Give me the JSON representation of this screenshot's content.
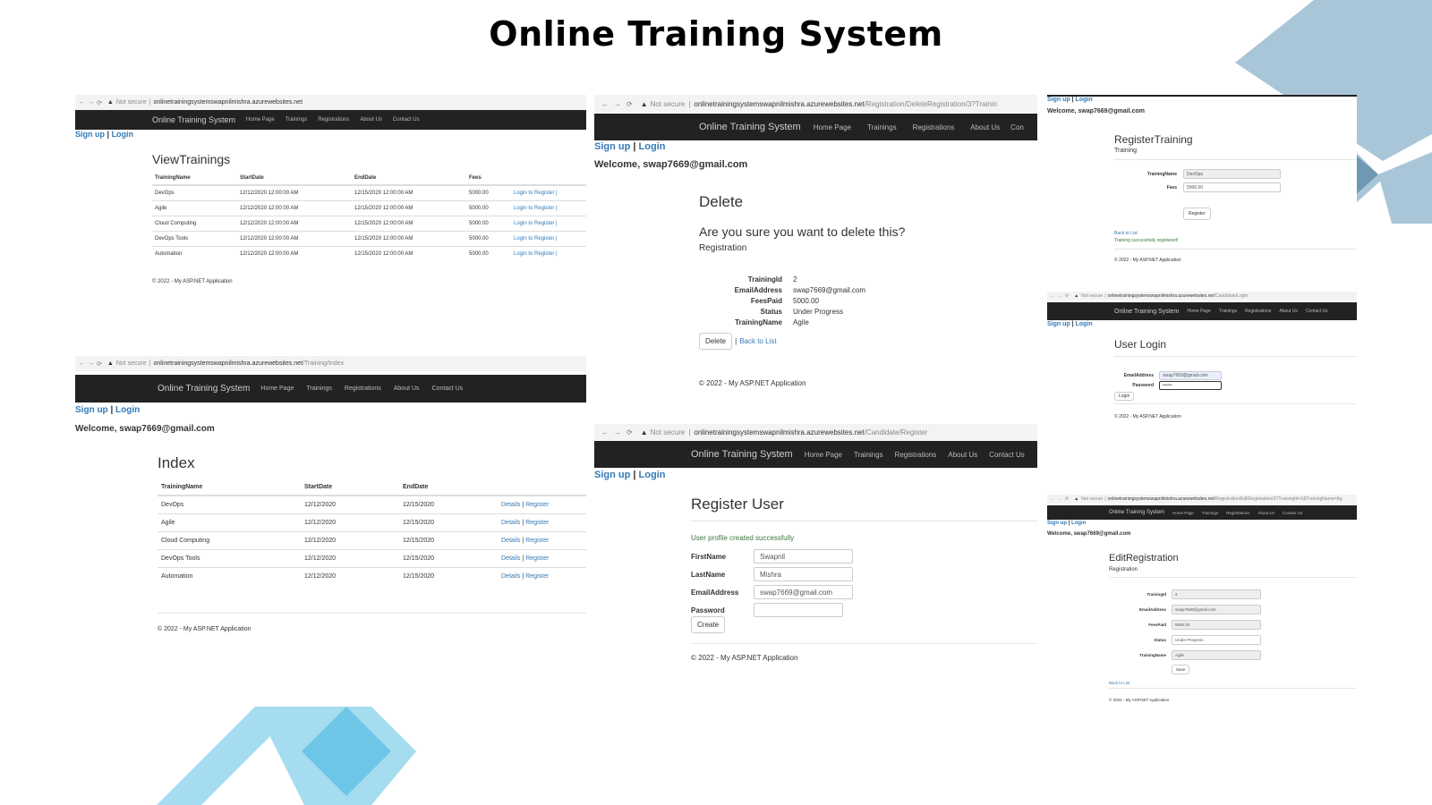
{
  "slide_title": "Online Training System",
  "colors": {
    "deco_dark": "#6f99b3",
    "deco_mid": "#a9c6d8",
    "deco_light": "#a5dcf0",
    "deco_cyan": "#6ec6e7",
    "navbar": "#222222",
    "link": "#337ab7",
    "success": "#3c763d"
  },
  "common": {
    "brand": "Online Training System",
    "nav": [
      "Home Page",
      "Trainings",
      "Registrations",
      "About Us",
      "Contact Us"
    ],
    "signup": "Sign up",
    "login": "Login",
    "sep": "|",
    "not_secure": "Not secure",
    "welcome": "Welcome, swap7669@gmail.com",
    "footer": "© 2022 - My ASP.NET Application",
    "host": "onlinetrainingsystemswapnilmishra.azurewebsites.net"
  },
  "view_trainings": {
    "url_path": "",
    "signup": "Sign up",
    "title": "ViewTrainings",
    "headers": [
      "TrainingName",
      "StartDate",
      "EndDate",
      "Fees"
    ],
    "rows": [
      {
        "name": "DevOps",
        "start": "12/12/2020 12:00:00 AM",
        "end": "12/15/2020 12:00:00 AM",
        "fees": "5000.00",
        "action": "Login to Register |"
      },
      {
        "name": "Agile",
        "start": "12/12/2020 12:00:00 AM",
        "end": "12/15/2020 12:00:00 AM",
        "fees": "5000.00",
        "action": "Login to Register |"
      },
      {
        "name": "Cloud Computing",
        "start": "12/12/2020 12:00:00 AM",
        "end": "12/15/2020 12:00:00 AM",
        "fees": "5000.00",
        "action": "Login to Register |"
      },
      {
        "name": "DevOps Tools",
        "start": "12/12/2020 12:00:00 AM",
        "end": "12/15/2020 12:00:00 AM",
        "fees": "5000.00",
        "action": "Login to Register |"
      },
      {
        "name": "Automation",
        "start": "12/12/2020 12:00:00 AM",
        "end": "12/15/2020 12:00:00 AM",
        "fees": "5000.00",
        "action": "Login to Register |"
      }
    ]
  },
  "training_index": {
    "url_path": "/Training/Index",
    "signup": "Sign up",
    "welcome": "Welcome, swap7669@gmail.com",
    "title": "Index",
    "headers": [
      "TrainingName",
      "StartDate",
      "EndDate"
    ],
    "rows": [
      {
        "name": "DevOps",
        "start": "12/12/2020",
        "end": "12/15/2020"
      },
      {
        "name": "Agile",
        "start": "12/12/2020",
        "end": "12/15/2020"
      },
      {
        "name": "Cloud Computing",
        "start": "12/12/2020",
        "end": "12/15/2020"
      },
      {
        "name": "DevOps Tools",
        "start": "12/12/2020",
        "end": "12/15/2020"
      },
      {
        "name": "Automation",
        "start": "12/12/2020",
        "end": "12/15/2020"
      }
    ],
    "action_details": "Details",
    "action_register": "Register"
  },
  "delete": {
    "url_path": "/Registration/DeleteRegistration/3?Trainin",
    "title": "Delete",
    "question": "Are you sure you want to delete this?",
    "subtitle": "Registration",
    "fields": [
      {
        "label": "TrainingId",
        "value": "2",
        "link": false
      },
      {
        "label": "EmailAddress",
        "value": "swap7669@gmail.com",
        "link": true
      },
      {
        "label": "FeesPaid",
        "value": "5000.00",
        "link": false
      },
      {
        "label": "Status",
        "value": "Under Progress",
        "link": false
      },
      {
        "label": "TrainingName",
        "value": "Agile",
        "link": false
      }
    ],
    "delete_btn": "Delete",
    "back": "Back to List"
  },
  "register_user": {
    "url_path": "/Candidate/Register",
    "nav_visible": "Con",
    "title": "Register User",
    "success": "User profile created successfully",
    "fields": [
      {
        "label": "FirstName",
        "value": "Swapnil"
      },
      {
        "label": "LastName",
        "value": "Mishra"
      },
      {
        "label": "EmailAddress",
        "value": "swap7669@gmail.com"
      },
      {
        "label": "Password",
        "value": ""
      }
    ],
    "create_btn": "Create"
  },
  "register_training": {
    "title": "RegisterTraining",
    "subtitle": "Training",
    "fields": [
      {
        "label": "TrainingName",
        "value": "DevOps"
      },
      {
        "label": "Fees",
        "value": "5000.00"
      }
    ],
    "register_btn": "Register",
    "back": "Back to List",
    "success": "Training successfully registered!"
  },
  "user_login": {
    "url_path": "/Candidate/Login",
    "title": "User Login",
    "fields": [
      {
        "label": "EmailAddress",
        "value": "swap7669@gmail.com"
      },
      {
        "label": "Password",
        "value": "••••••"
      }
    ],
    "login_btn": "Login"
  },
  "edit_registration": {
    "url_path": "/Registration/EditRegistration/3?TrainingId=2&TrainingName=Ag",
    "title": "EditRegistration",
    "subtitle": "Registration",
    "fields": [
      {
        "label": "TrainingId",
        "value": "2",
        "ro": true
      },
      {
        "label": "EmailAddress",
        "value": "swap7669@gmail.com",
        "ro": true
      },
      {
        "label": "FeesPaid",
        "value": "5000.00",
        "ro": true
      },
      {
        "label": "Status",
        "value": "Under Progress",
        "ro": false
      },
      {
        "label": "TrainingName",
        "value": "Agile",
        "ro": true
      }
    ],
    "save_btn": "Save",
    "back": "Back to List"
  }
}
